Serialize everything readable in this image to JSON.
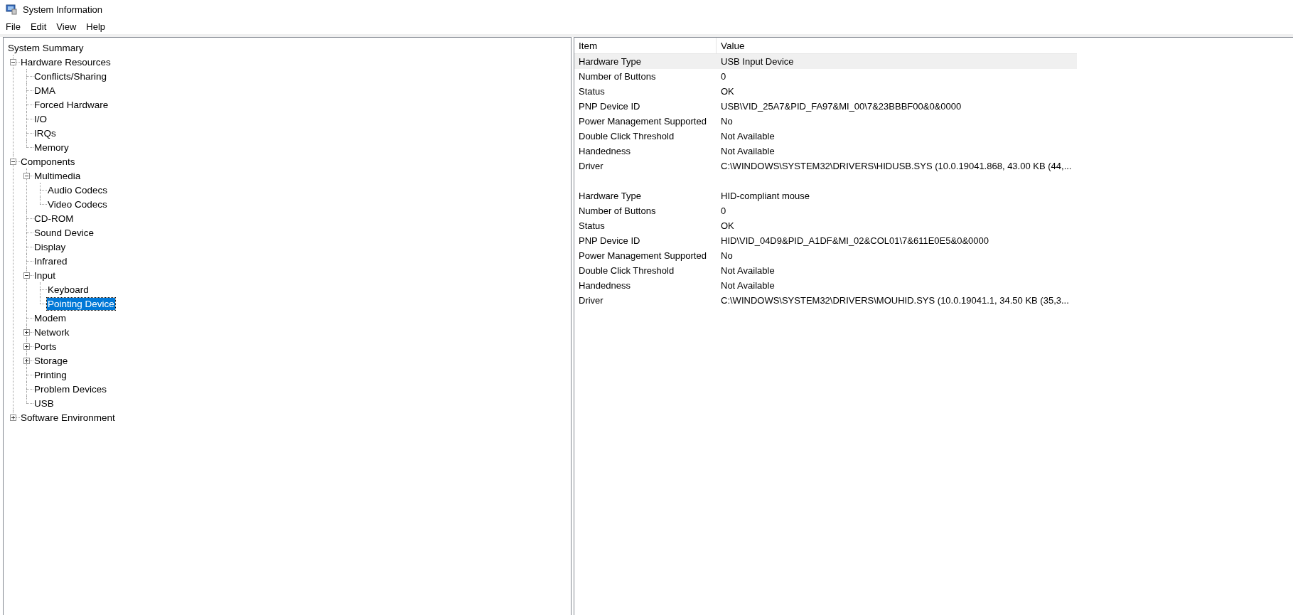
{
  "window": {
    "title": "System Information"
  },
  "menu": [
    "File",
    "Edit",
    "View",
    "Help"
  ],
  "tree": {
    "label": "System Summary",
    "selected": false,
    "children": [
      {
        "label": "Hardware Resources",
        "selected": false,
        "expanded": true,
        "children": [
          {
            "label": "Conflicts/Sharing",
            "selected": false
          },
          {
            "label": "DMA",
            "selected": false
          },
          {
            "label": "Forced Hardware",
            "selected": false
          },
          {
            "label": "I/O",
            "selected": false
          },
          {
            "label": "IRQs",
            "selected": false
          },
          {
            "label": "Memory",
            "selected": false
          }
        ]
      },
      {
        "label": "Components",
        "selected": false,
        "expanded": true,
        "children": [
          {
            "label": "Multimedia",
            "selected": false,
            "expanded": true,
            "children": [
              {
                "label": "Audio Codecs",
                "selected": false
              },
              {
                "label": "Video Codecs",
                "selected": false
              }
            ]
          },
          {
            "label": "CD-ROM",
            "selected": false
          },
          {
            "label": "Sound Device",
            "selected": false
          },
          {
            "label": "Display",
            "selected": false
          },
          {
            "label": "Infrared",
            "selected": false
          },
          {
            "label": "Input",
            "selected": false,
            "expanded": true,
            "children": [
              {
                "label": "Keyboard",
                "selected": false
              },
              {
                "label": "Pointing Device",
                "selected": true
              }
            ]
          },
          {
            "label": "Modem",
            "selected": false
          },
          {
            "label": "Network",
            "selected": false,
            "expanded": false
          },
          {
            "label": "Ports",
            "selected": false,
            "expanded": false
          },
          {
            "label": "Storage",
            "selected": false,
            "expanded": false
          },
          {
            "label": "Printing",
            "selected": false
          },
          {
            "label": "Problem Devices",
            "selected": false
          },
          {
            "label": "USB",
            "selected": false
          }
        ]
      },
      {
        "label": "Software Environment",
        "selected": false,
        "expanded": false
      }
    ]
  },
  "table": {
    "columns": [
      "Item",
      "Value"
    ],
    "groups": [
      {
        "rows": [
          {
            "item": "Hardware Type",
            "value": "USB Input Device",
            "selected": true
          },
          {
            "item": "Number of Buttons",
            "value": "0",
            "selected": false
          },
          {
            "item": "Status",
            "value": "OK",
            "selected": false
          },
          {
            "item": "PNP Device ID",
            "value": "USB\\VID_25A7&PID_FA97&MI_00\\7&23BBBF00&0&0000",
            "selected": false
          },
          {
            "item": "Power Management Supported",
            "value": "No",
            "selected": false
          },
          {
            "item": "Double Click Threshold",
            "value": "Not Available",
            "selected": false
          },
          {
            "item": "Handedness",
            "value": "Not Available",
            "selected": false
          },
          {
            "item": "Driver",
            "value": "C:\\WINDOWS\\SYSTEM32\\DRIVERS\\HIDUSB.SYS (10.0.19041.868, 43.00 KB (44,...",
            "selected": false
          }
        ]
      },
      {
        "rows": [
          {
            "item": "Hardware Type",
            "value": "HID-compliant mouse",
            "selected": false
          },
          {
            "item": "Number of Buttons",
            "value": "0",
            "selected": false
          },
          {
            "item": "Status",
            "value": "OK",
            "selected": false
          },
          {
            "item": "PNP Device ID",
            "value": "HID\\VID_04D9&PID_A1DF&MI_02&COL01\\7&611E0E5&0&0000",
            "selected": false
          },
          {
            "item": "Power Management Supported",
            "value": "No",
            "selected": false
          },
          {
            "item": "Double Click Threshold",
            "value": "Not Available",
            "selected": false
          },
          {
            "item": "Handedness",
            "value": "Not Available",
            "selected": false
          },
          {
            "item": "Driver",
            "value": "C:\\WINDOWS\\SYSTEM32\\DRIVERS\\MOUHID.SYS (10.0.19041.1, 34.50 KB (35,3...",
            "selected": false
          }
        ]
      }
    ]
  }
}
